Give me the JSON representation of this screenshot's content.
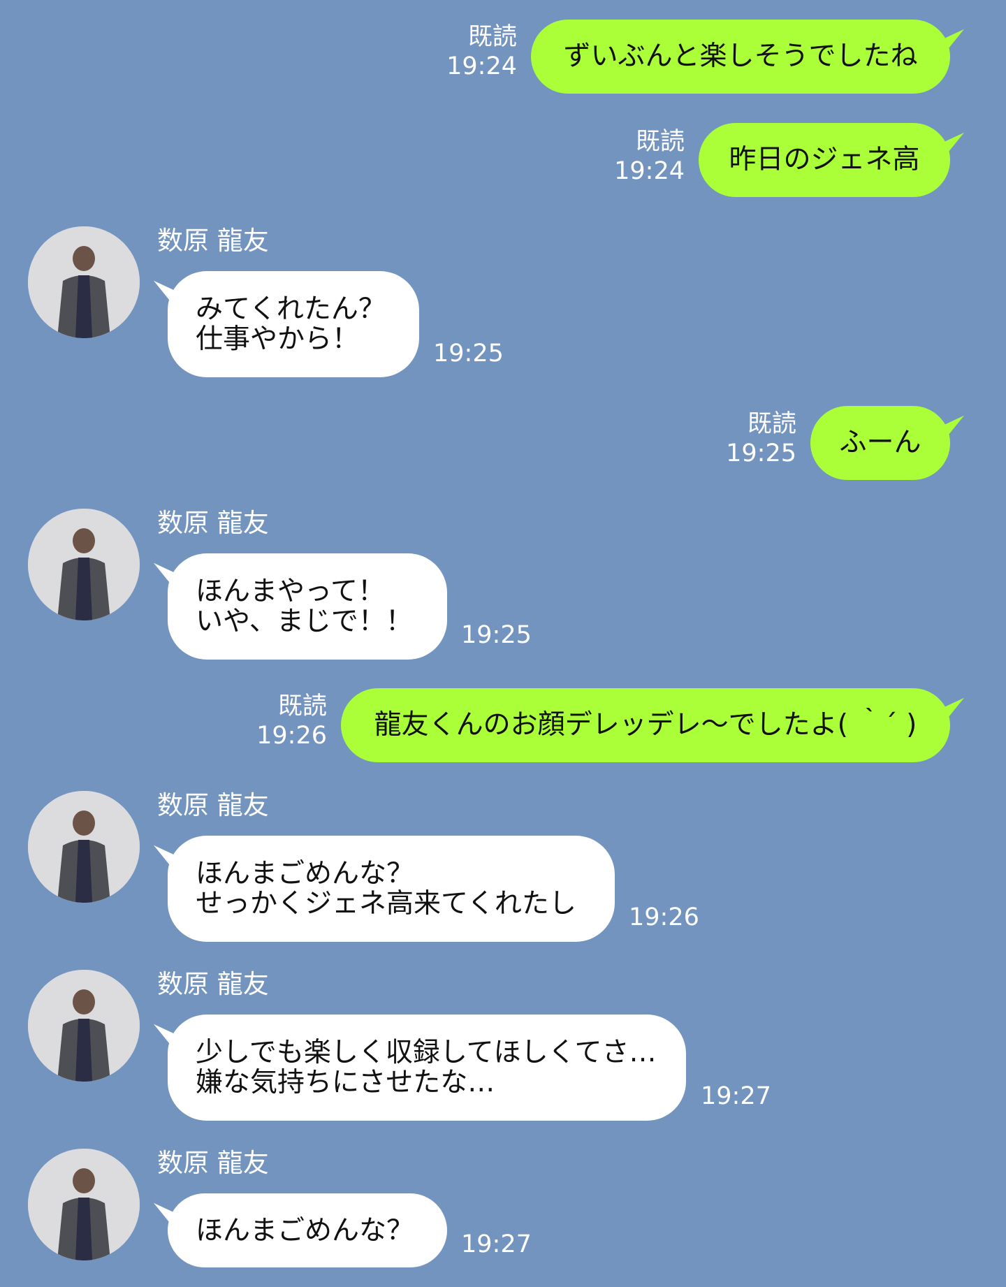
{
  "contact": {
    "name": "数原 龍友"
  },
  "read_label": "既読",
  "messages": [
    {
      "side": "sent",
      "text": "ずいぶんと楽しそうでしたね",
      "time": "19:24",
      "read": "既読"
    },
    {
      "side": "sent",
      "text": "昨日のジェネ高",
      "time": "19:24",
      "read": "既読"
    },
    {
      "side": "received",
      "sender": "数原 龍友",
      "lines": [
        "みてくれたん？",
        "仕事やから！"
      ],
      "time": "19:25"
    },
    {
      "side": "sent",
      "text": "ふーん",
      "time": "19:25",
      "read": "既読"
    },
    {
      "side": "received",
      "sender": "数原 龍友",
      "lines": [
        "ほんまやって！",
        "いや、まじで！！"
      ],
      "time": "19:25"
    },
    {
      "side": "sent",
      "text": "龍友くんのお顔デレッデレ〜でしたよ( ｀´ )",
      "time": "19:26",
      "read": "既読"
    },
    {
      "side": "received",
      "sender": "数原 龍友",
      "lines": [
        "ほんまごめんな？",
        "せっかくジェネ高来てくれたし"
      ],
      "time": "19:26"
    },
    {
      "side": "received",
      "sender": "数原 龍友",
      "lines": [
        "少しでも楽しく収録してほしくてさ…",
        "嫌な気持ちにさせたな…"
      ],
      "time": "19:27"
    },
    {
      "side": "received",
      "sender": "数原 龍友",
      "lines": [
        "ほんまごめんな？"
      ],
      "time": "19:27"
    }
  ],
  "colors": {
    "background": "#7494c0",
    "sent_bubble": "#aaff38",
    "received_bubble": "#ffffff",
    "meta_text": "#ffffff"
  }
}
